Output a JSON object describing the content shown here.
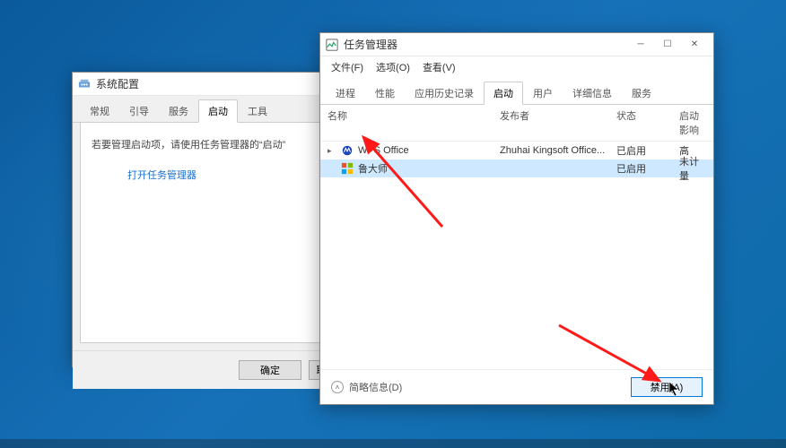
{
  "msconfig": {
    "title": "系统配置",
    "tabs": [
      "常规",
      "引导",
      "服务",
      "启动",
      "工具"
    ],
    "active_tab_index": 3,
    "instruction": "若要管理启动项，请使用任务管理器的“启动”",
    "link_text": "打开任务管理器",
    "buttons": {
      "ok": "确定",
      "cancel": "取"
    }
  },
  "taskmgr": {
    "title": "任务管理器",
    "menus": [
      "文件(F)",
      "选项(O)",
      "查看(V)"
    ],
    "tabs": [
      "进程",
      "性能",
      "应用历史记录",
      "启动",
      "用户",
      "详细信息",
      "服务"
    ],
    "active_tab_index": 3,
    "columns": {
      "name": "名称",
      "publisher": "发布者",
      "status": "状态",
      "impact": "启动影响"
    },
    "rows": [
      {
        "icon": "wps",
        "name": "WPS Office",
        "publisher": "Zhuhai Kingsoft Office...",
        "status": "已启用",
        "impact": "高",
        "selected": false,
        "expandable": true
      },
      {
        "icon": "ludashi",
        "name": "鲁大师",
        "publisher": "",
        "status": "已启用",
        "impact": "未计量",
        "selected": true,
        "expandable": false
      }
    ],
    "less_detail": "简略信息(D)",
    "disable_btn": "禁用(A)"
  }
}
